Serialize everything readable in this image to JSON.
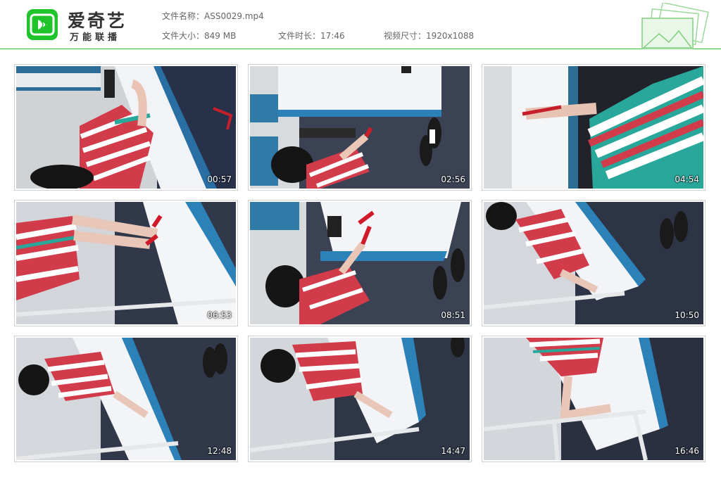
{
  "brand": {
    "title": "爱奇艺",
    "subtitle": "万能联播",
    "colors": {
      "accent": "#1fc42a",
      "divider": "#3db83a"
    }
  },
  "file_info": {
    "name": "文件名称：ASS0029.mp4",
    "size": "文件大小：849 MB",
    "duration": "文件时长：17:46",
    "resolution": "视频尺寸：1920x1088"
  },
  "thumbnails": [
    {
      "time": "00:57",
      "scene": "bed-bottom-left"
    },
    {
      "time": "02:56",
      "scene": "bed-top-shoes"
    },
    {
      "time": "04:54",
      "scene": "closeup-sweater"
    },
    {
      "time": "06:53",
      "scene": "legs-red-heels"
    },
    {
      "time": "08:51",
      "scene": "bed-top-shoes"
    },
    {
      "time": "10:50",
      "scene": "bed-diagonal-rail"
    },
    {
      "time": "12:48",
      "scene": "bed-left-lying"
    },
    {
      "time": "14:47",
      "scene": "bed-center-lying"
    },
    {
      "time": "16:46",
      "scene": "bed-rail-legs"
    }
  ]
}
